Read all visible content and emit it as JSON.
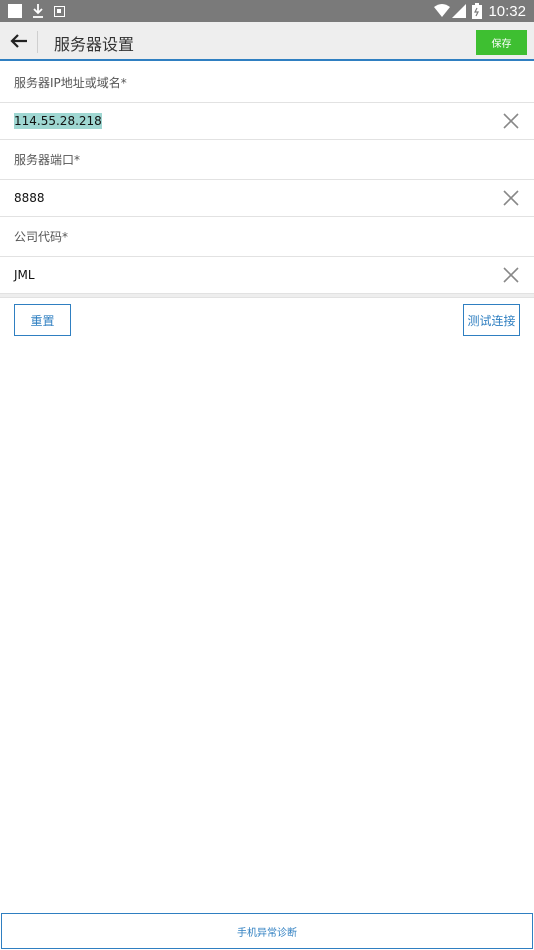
{
  "status_bar": {
    "time": "10:32",
    "icons": [
      "square-notification-icon",
      "download-icon",
      "a-icon",
      "wifi-icon",
      "signal-icon",
      "battery-icon"
    ]
  },
  "toolbar": {
    "title": "服务器设置",
    "save_label": "保存"
  },
  "fields": [
    {
      "label": "服务器IP地址或域名*",
      "value": "114.55.28.218"
    },
    {
      "label": "服务器端口*",
      "value": "8888"
    },
    {
      "label": "公司代码*",
      "value": "JML"
    }
  ],
  "actions": {
    "reset_label": "重置",
    "test_label": "测试连接"
  },
  "footer": {
    "diagnose_label": "手机异常诊断"
  },
  "colors": {
    "accent": "#2f7fc1",
    "save_green": "#3ebf31",
    "selection": "#9fd7d2",
    "status_bar": "#7a7a7a"
  }
}
